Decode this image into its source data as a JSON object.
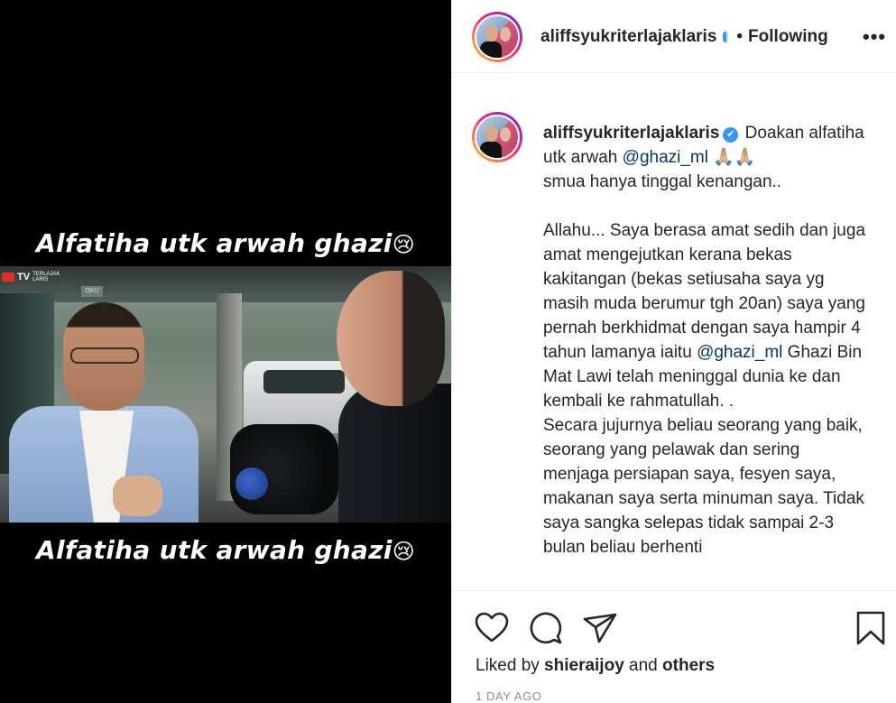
{
  "media": {
    "caption_top": "Alfatiha utk arwah ghazi",
    "caption_bottom": "Alfatiha utk arwah ghazi",
    "caption_emoji": "😢",
    "channel_logo": "TV",
    "channel_logo_small": "TERLAJAK\nLARIS",
    "sign_text": "OKU"
  },
  "header": {
    "username": "aliffsyukriterlajaklaris",
    "separator": "•",
    "follow_status": "Following",
    "more_label": "•••"
  },
  "comment": {
    "username": "aliffsyukriterlajaklaris",
    "verified_mark": "✔",
    "part1": " Doakan alfatiha utk arwah ",
    "mention1": "@ghazi_ml",
    "part2": " 🙏🏼🙏🏼\nsmua hanya tinggal kenangan..\n\nAllahu... Saya berasa amat sedih dan juga amat mengejutkan kerana bekas kakitangan (bekas setiusaha saya yg masih muda berumur tgh 20an) saya yang pernah berkhidmat dengan saya hampir 4 tahun lamanya iaitu ",
    "mention2": "@ghazi_ml",
    "part3": " Ghazi Bin Mat Lawi telah meninggal dunia ke dan kembali ke rahmatullah. .\nSecara jujurnya beliau seorang yang baik, seorang yang pelawak dan sering menjaga persiapan saya, fesyen saya, makanan saya serta minuman saya. Tidak saya sangka selepas tidak sampai 2-3 bulan beliau berhenti"
  },
  "actions": {
    "icons": [
      "heart-icon",
      "comment-icon",
      "share-icon",
      "bookmark-icon"
    ]
  },
  "likes": {
    "prefix": "Liked by ",
    "user": "shieraijoy",
    "middle": " and ",
    "others": "others"
  },
  "timestamp": "1 DAY AGO"
}
